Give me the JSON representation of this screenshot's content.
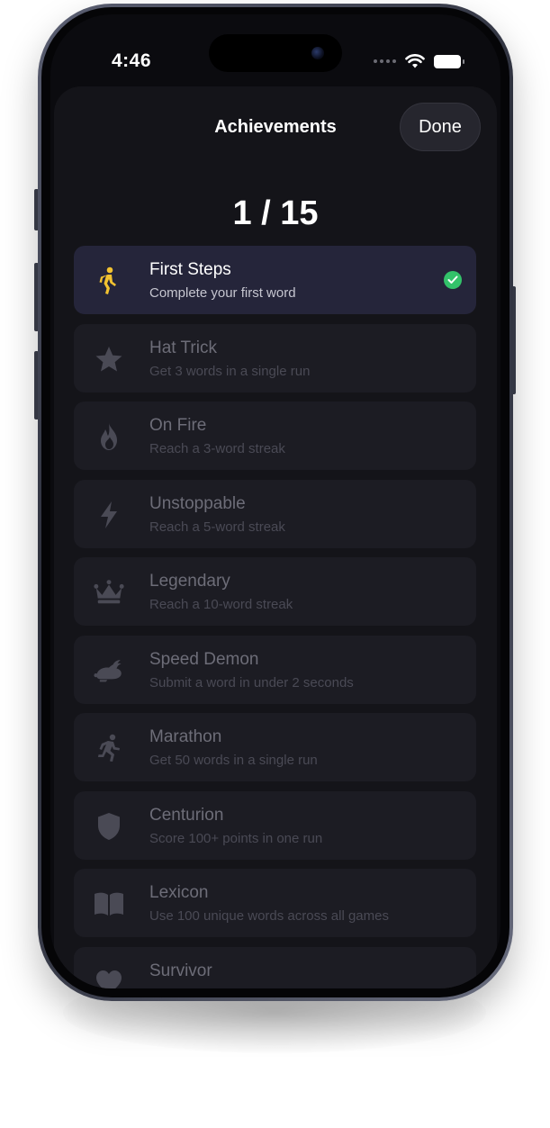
{
  "status_bar": {
    "time": "4:46"
  },
  "header": {
    "title": "Achievements",
    "done_label": "Done"
  },
  "progress": {
    "text": "1 / 15",
    "unlocked": 1,
    "total": 15
  },
  "colors": {
    "accent_yellow": "#f2c230",
    "check_green": "#33c26a"
  },
  "achievements": [
    {
      "title": "First Steps",
      "description": "Complete your first word",
      "icon": "walking-figure-icon",
      "unlocked": true
    },
    {
      "title": "Hat Trick",
      "description": "Get 3 words in a single run",
      "icon": "star-icon",
      "unlocked": false
    },
    {
      "title": "On Fire",
      "description": "Reach a 3-word streak",
      "icon": "flame-icon",
      "unlocked": false
    },
    {
      "title": "Unstoppable",
      "description": "Reach a 5-word streak",
      "icon": "lightning-bolt-icon",
      "unlocked": false
    },
    {
      "title": "Legendary",
      "description": "Reach a 10-word streak",
      "icon": "crown-icon",
      "unlocked": false
    },
    {
      "title": "Speed Demon",
      "description": "Submit a word in under 2 seconds",
      "icon": "rabbit-icon",
      "unlocked": false
    },
    {
      "title": "Marathon",
      "description": "Get 50 words in a single run",
      "icon": "running-figure-icon",
      "unlocked": false
    },
    {
      "title": "Centurion",
      "description": "Score 100+ points in one run",
      "icon": "shield-icon",
      "unlocked": false
    },
    {
      "title": "Lexicon",
      "description": "Use 100 unique words across all games",
      "icon": "book-icon",
      "unlocked": false
    },
    {
      "title": "Survivor",
      "description": "",
      "icon": "heart-icon",
      "unlocked": false
    }
  ]
}
